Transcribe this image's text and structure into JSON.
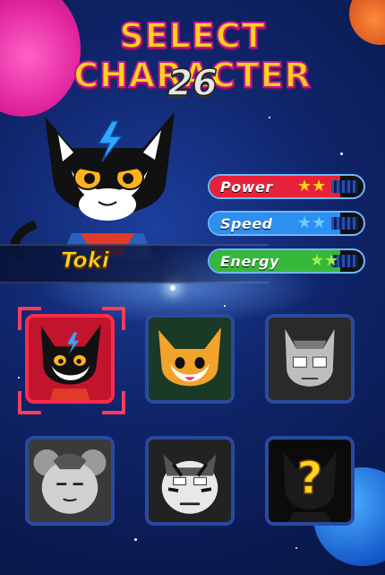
{
  "screen": {
    "title": "Select Character",
    "countdown": "26"
  },
  "selected_character": {
    "name": "Toki",
    "stats": [
      {
        "label": "Power",
        "stars": 2,
        "color": "#e8213a",
        "star_color": "#ffd21c"
      },
      {
        "label": "Speed",
        "stars": 2,
        "color": "#2d8ff0",
        "star_color": "#6fd0ff"
      },
      {
        "label": "Energy",
        "stars": 2,
        "color": "#36b83a",
        "star_color": "#9cf04a"
      }
    ]
  },
  "roster": [
    {
      "slot": "toki",
      "selected": true,
      "locked": false,
      "icon": "black-cat-icon"
    },
    {
      "slot": "fox",
      "selected": false,
      "locked": false,
      "icon": "orange-fox-icon"
    },
    {
      "slot": "grey-cat",
      "selected": false,
      "locked": false,
      "icon": "grey-cat-icon"
    },
    {
      "slot": "grey-mouse",
      "selected": false,
      "locked": false,
      "icon": "grey-mouse-icon"
    },
    {
      "slot": "tiger",
      "selected": false,
      "locked": false,
      "icon": "tiger-icon"
    },
    {
      "slot": "mystery",
      "selected": false,
      "locked": true,
      "icon": "question-mark-icon",
      "label": "?"
    }
  ],
  "colors": {
    "title_fill": "#ffd21c",
    "title_outline": "#c2188d",
    "background": "#0f2468",
    "selection": "#ff2a4d"
  }
}
